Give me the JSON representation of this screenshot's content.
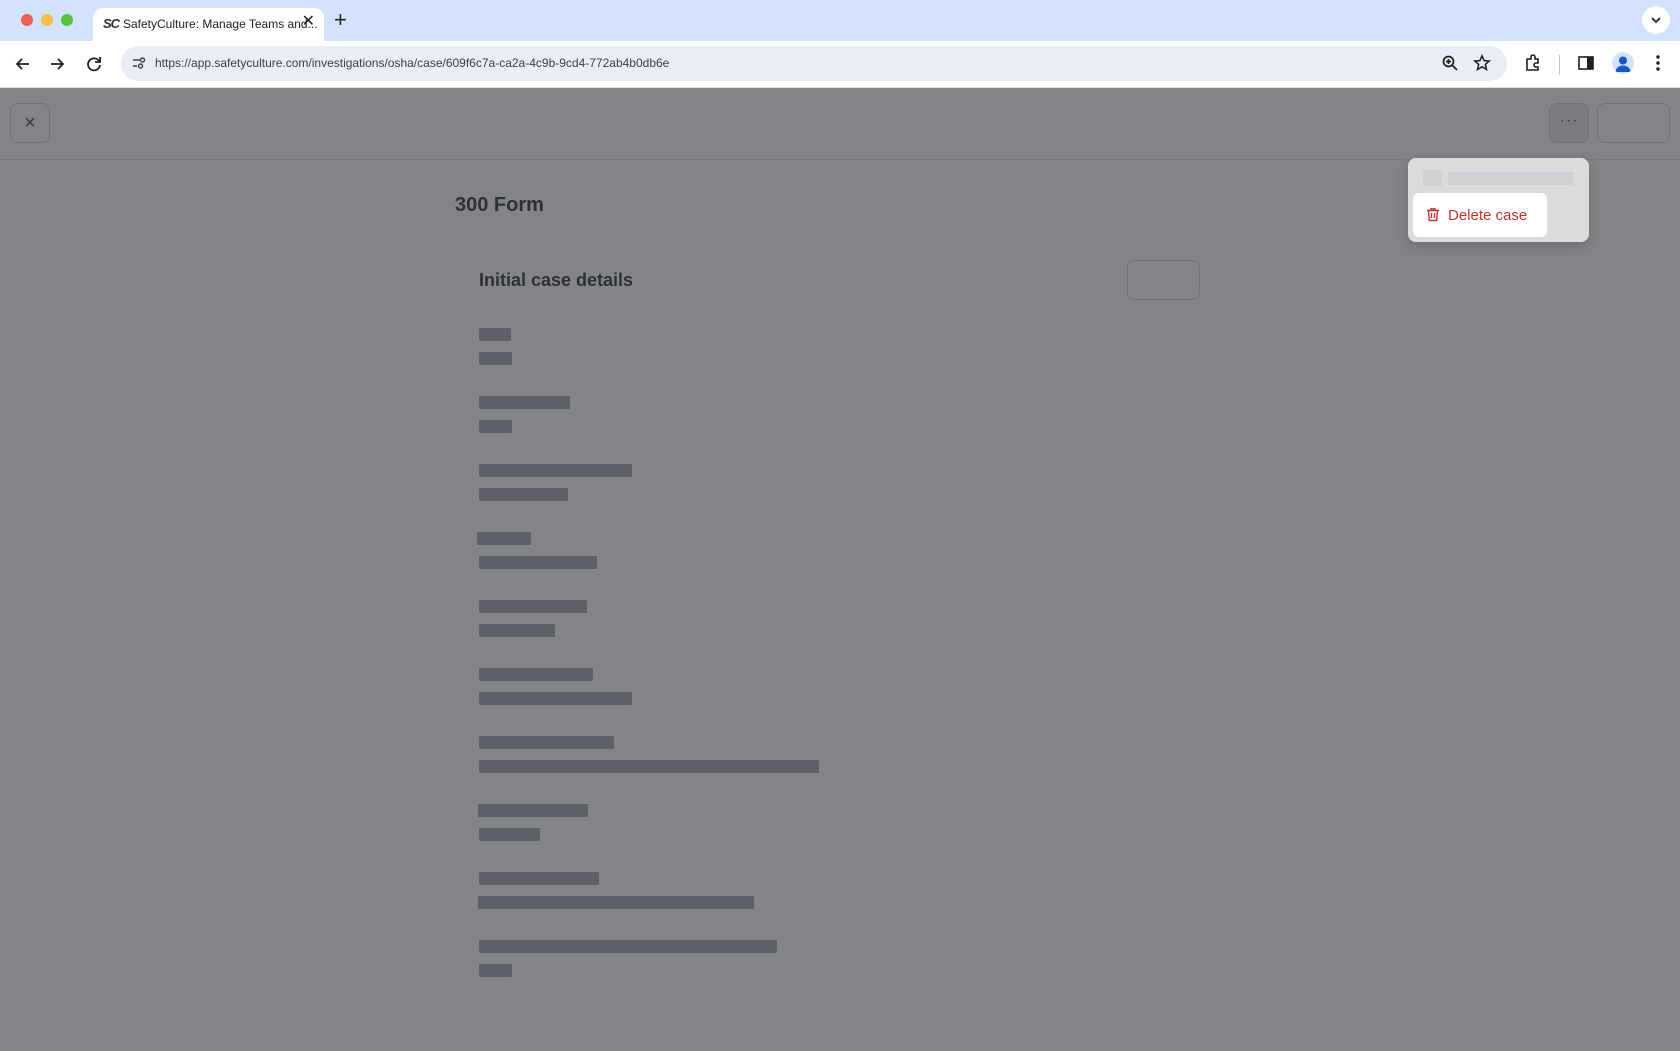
{
  "browser": {
    "tab_title": "SafetyCulture: Manage Teams and...",
    "tab_favicon": "SC",
    "url": "https://app.safetyculture.com/investigations/osha/case/609f6c7a-ca2a-4c9b-9cd4-772ab4b0db6e",
    "icons": [
      "back-icon",
      "forward-icon",
      "reload-icon",
      "site-info-icon",
      "zoom-icon",
      "star-icon",
      "extensions-icon",
      "side-panel-icon",
      "profile-icon",
      "kebab-menu-icon"
    ]
  },
  "header": {
    "close_label": "×",
    "more_label": "···"
  },
  "page": {
    "title": "300 Form",
    "card_title": "Initial case details"
  },
  "menu": {
    "delete_label": "Delete case",
    "delete_color": "#c0352b"
  },
  "colors": {
    "overlay": "rgba(55,57,63,0.62)",
    "chrome_tab_bar": "#d3e3fd"
  }
}
